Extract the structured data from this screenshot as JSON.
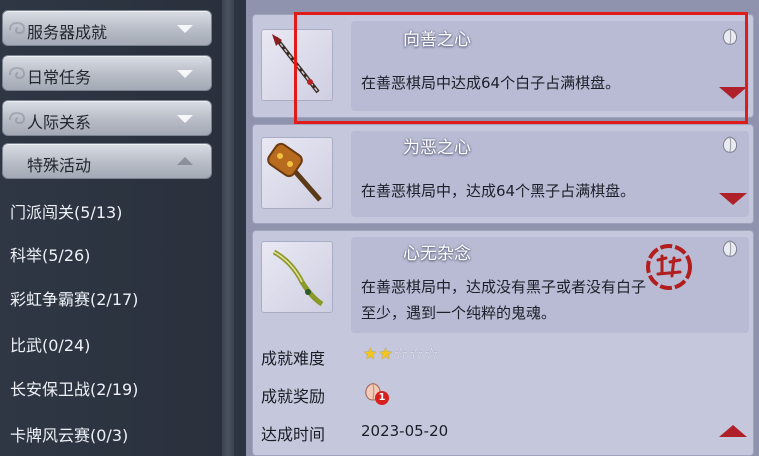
{
  "sidebar": {
    "categories": [
      {
        "label": "服务器成就",
        "arrow": "down"
      },
      {
        "label": "日常任务",
        "arrow": "down"
      },
      {
        "label": "人际关系",
        "arrow": "down"
      },
      {
        "label": "特殊活动",
        "arrow": "up"
      }
    ],
    "items": [
      {
        "label": "门派闯关(5/13)"
      },
      {
        "label": "科举(5/26)"
      },
      {
        "label": "彩虹争霸赛(2/17)"
      },
      {
        "label": "比武(0/24)"
      },
      {
        "label": "长安保卫战(2/19)"
      },
      {
        "label": "卡牌风云赛(0/3)"
      }
    ]
  },
  "achievements": [
    {
      "title": "向善之心",
      "description": "在善恶棋局中达成64个白子占满棋盘。",
      "thumb_icon": "spear-weapon-icon",
      "reward_icon": "peach-icon",
      "toggle": "expand"
    },
    {
      "title": "为恶之心",
      "description": "在善恶棋局中，达成64个黑子占满棋盘。",
      "thumb_icon": "hammer-weapon-icon",
      "reward_icon": "peach-icon",
      "toggle": "expand"
    },
    {
      "title": "心无杂念",
      "description_line1": "在善恶棋局中，达成没有黑子或者没有白子",
      "description_line2": "至少，遇到一个纯粹的鬼魂。",
      "thumb_icon": "curved-sword-icon",
      "reward_icon": "peach-icon",
      "toggle": "collapse",
      "completed_seal_icon": "completed-seal-icon",
      "difficulty_label": "成就难度",
      "difficulty_rating": 2,
      "difficulty_max": 5,
      "difficulty_stars": "★★☆☆☆",
      "reward_label": "成就奖励",
      "reward_count": "1",
      "time_label": "达成时间",
      "time_value": "2023-05-20"
    }
  ],
  "colors": {
    "highlight_border": "#e11a1a",
    "toggle_triangle": "#b0202a",
    "star_filled": "#f4c61d"
  }
}
